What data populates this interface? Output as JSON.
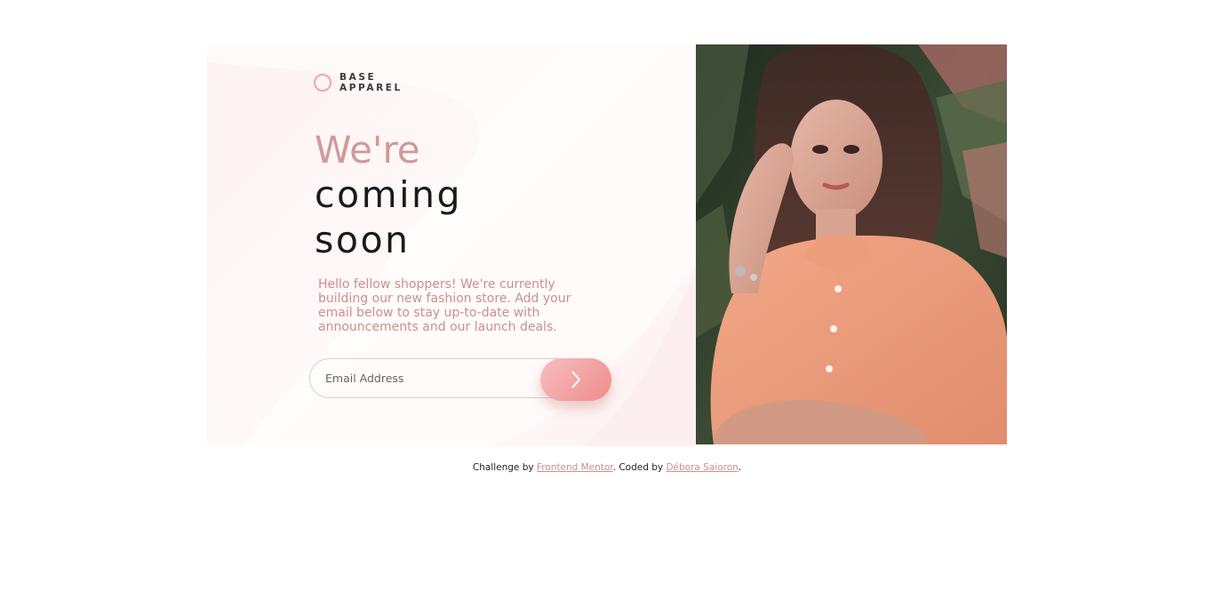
{
  "brand": {
    "line1": "BASE",
    "line2": "APPAREL"
  },
  "hero": {
    "headline_light": "We're",
    "headline_dark_1": "coming",
    "headline_dark_2": "soon",
    "intro": "Hello fellow shoppers! We're currently building our new fashion store. Add your email below to stay up-to-date with announcements and our launch deals."
  },
  "form": {
    "email_placeholder": "Email Address",
    "submit_icon": "chevron-right-icon"
  },
  "photo": {
    "description_icon": "hero-photo"
  },
  "footer": {
    "prefix": "Challenge by ",
    "link1": "Frontend Mentor",
    "middle": ". Coded by ",
    "link2": "Débora Saioron",
    "suffix": "."
  },
  "colors": {
    "accent": "#f0a6a6",
    "accent_dark": "#ce9797",
    "text_dark": "#423a3a"
  }
}
